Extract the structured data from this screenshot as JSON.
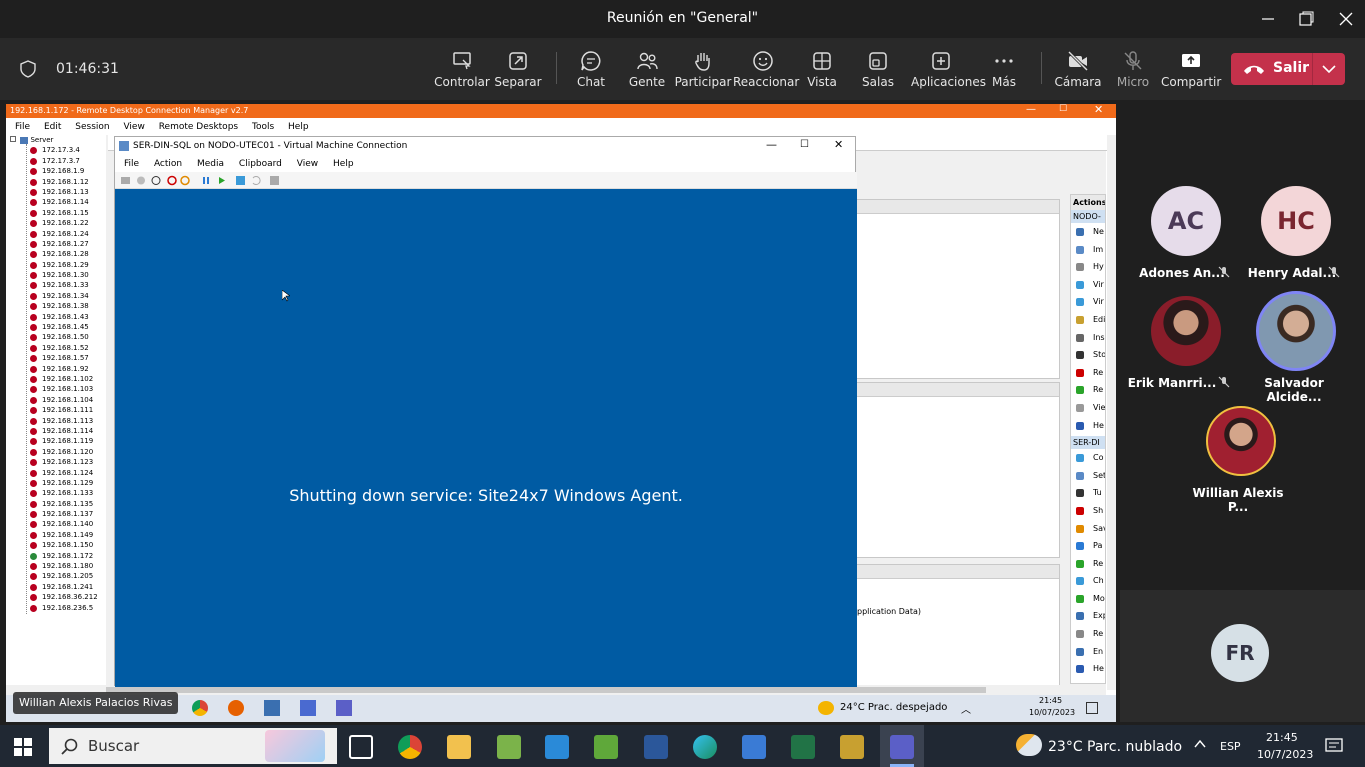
{
  "window": {
    "title": "Reunión en \"General\""
  },
  "meeting": {
    "timer": "01:46:31",
    "toolbar": [
      {
        "id": "controlar",
        "label": "Controlar",
        "icon": "control-icon"
      },
      {
        "id": "separar",
        "label": "Separar",
        "icon": "popout-icon"
      },
      {
        "id": "chat",
        "label": "Chat",
        "icon": "chat-icon"
      },
      {
        "id": "gente",
        "label": "Gente",
        "icon": "people-icon"
      },
      {
        "id": "participar",
        "label": "Participar",
        "icon": "raise-hand-icon"
      },
      {
        "id": "reaccionar",
        "label": "Reaccionar",
        "icon": "smile-icon"
      },
      {
        "id": "vista",
        "label": "Vista",
        "icon": "grid-icon"
      },
      {
        "id": "salas",
        "label": "Salas",
        "icon": "rooms-icon"
      },
      {
        "id": "aplicaciones",
        "label": "Aplicaciones",
        "icon": "plus-icon"
      },
      {
        "id": "mas",
        "label": "Más",
        "icon": "more-icon"
      },
      {
        "id": "camara",
        "label": "Cámara",
        "icon": "camera-off-icon"
      },
      {
        "id": "micro",
        "label": "Micro",
        "icon": "mic-off-icon"
      },
      {
        "id": "compartir",
        "label": "Compartir",
        "icon": "share-icon"
      }
    ],
    "leave_label": "Salir",
    "leave_color": "#c4314b"
  },
  "shared_screen": {
    "presenter_label": "Willian Alexis Palacios Rivas",
    "rdcm": {
      "title": "192.168.1.172 - Remote Desktop Connection Manager v2.7",
      "menu": [
        "File",
        "Edit",
        "Session",
        "View",
        "Remote Desktops",
        "Tools",
        "Help"
      ],
      "tree_root": "Server",
      "servers": [
        "172.17.3.4",
        "172.17.3.7",
        "192.168.1.9",
        "192.168.1.12",
        "192.168.1.13",
        "192.168.1.14",
        "192.168.1.15",
        "192.168.1.22",
        "192.168.1.24",
        "192.168.1.27",
        "192.168.1.28",
        "192.168.1.29",
        "192.168.1.30",
        "192.168.1.33",
        "192.168.1.34",
        "192.168.1.38",
        "192.168.1.43",
        "192.168.1.45",
        "192.168.1.50",
        "192.168.1.52",
        "192.168.1.57",
        "192.168.1.92",
        "192.168.1.102",
        "192.168.1.103",
        "192.168.1.104",
        "192.168.1.111",
        "192.168.1.113",
        "192.168.1.114",
        "192.168.1.119",
        "192.168.1.120",
        "192.168.1.123",
        "192.168.1.124",
        "192.168.1.129",
        "192.168.1.133",
        "192.168.1.135",
        "192.168.1.137",
        "192.168.1.140",
        "192.168.1.149",
        "192.168.1.150",
        "192.168.1.172",
        "192.168.1.180",
        "192.168.1.205",
        "192.168.1.241",
        "192.168.36.212",
        "192.168.236.5"
      ],
      "active_server": "192.168.1.172"
    },
    "hyperv": {
      "actions_header": "Actions",
      "node_header": "NODO-",
      "actions": [
        "Ne",
        "Im",
        "Hy",
        "Vir",
        "Vir",
        "Edi",
        "Ins",
        "Sto",
        "Re",
        "Re",
        "Vie",
        "He"
      ],
      "vm_header": "SER-DI",
      "vm_actions": [
        "Co",
        "Set",
        "Tu",
        "Sh",
        "Sav",
        "Pa",
        "Re",
        "Ch",
        "Mo",
        "Exp",
        "Re",
        "En",
        "He"
      ],
      "snippet": "pplication Data)"
    },
    "vm_window": {
      "title": "SER-DIN-SQL on NODO-UTEC01 - Virtual Machine Connection",
      "menu": [
        "File",
        "Action",
        "Media",
        "Clipboard",
        "View",
        "Help"
      ],
      "message": "Shutting down service: Site24x7 Windows Agent."
    },
    "inner_taskbar": {
      "weather": "24°C  Prac. despejado",
      "time": "21:45",
      "date": "10/07/2023"
    }
  },
  "participants": [
    {
      "initials": "AC",
      "name": "Adones An...",
      "bg": "#e6dcea",
      "fg": "#4b3a57",
      "muted": true
    },
    {
      "initials": "HC",
      "name": "Henry Adal...",
      "bg": "#f3d6d8",
      "fg": "#7a2630",
      "muted": true
    },
    {
      "initials": "",
      "name": "Erik Manrri...",
      "bg": "#3a2424",
      "muted": true
    },
    {
      "initials": "",
      "name": "Salvador Alcide...",
      "bg": "#556677",
      "muted": false
    },
    {
      "initials": "",
      "name": "Willian Alexis P...",
      "bg": "#7a5040",
      "muted": false
    }
  ],
  "fr_tile": {
    "initials": "FR"
  },
  "taskbar": {
    "search_placeholder": "Buscar",
    "weather": "23°C  Parc. nublado",
    "lang": "ESP",
    "time": "21:45",
    "date": "10/7/2023"
  }
}
